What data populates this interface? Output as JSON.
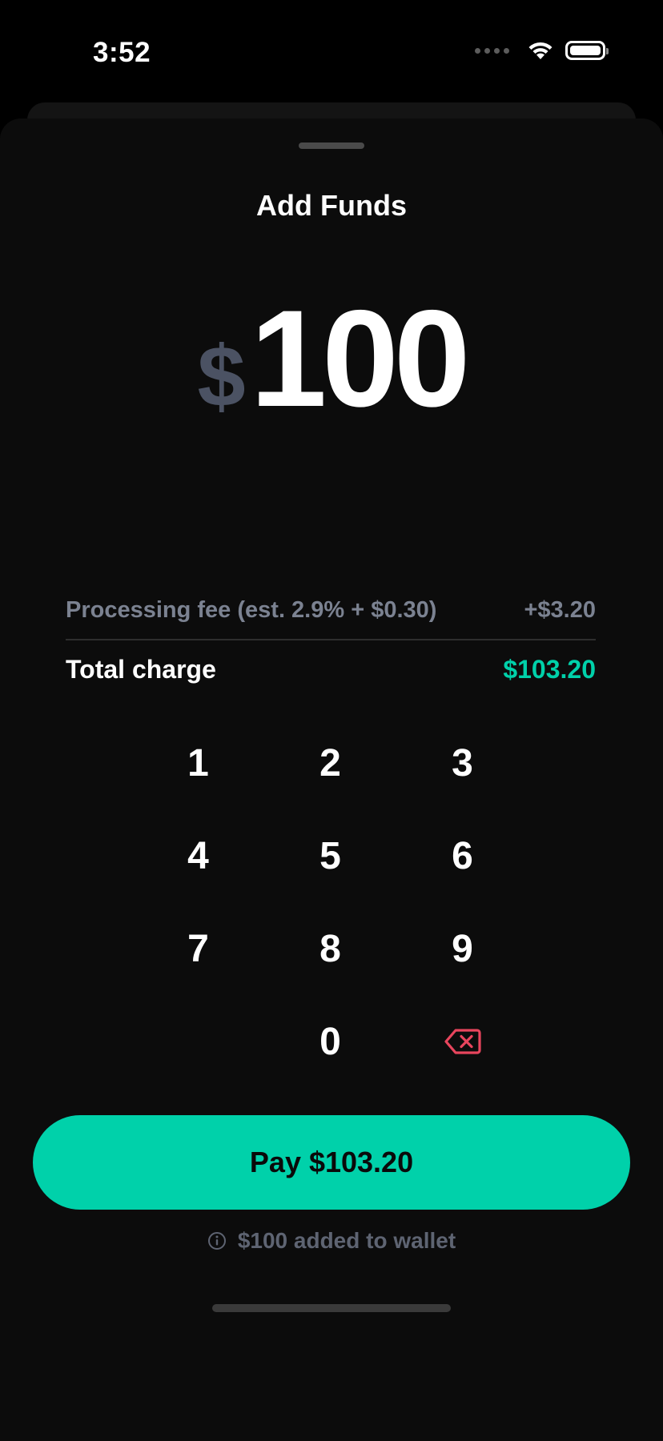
{
  "status_bar": {
    "time": "3:52"
  },
  "sheet": {
    "title": "Add Funds"
  },
  "amount": {
    "currency_symbol": "$",
    "value": "100"
  },
  "fees": {
    "processing_label": "Processing fee (est. 2.9% + $0.30)",
    "processing_value": "+$3.20",
    "total_label": "Total charge",
    "total_value": "$103.20"
  },
  "keypad": {
    "keys": [
      "1",
      "2",
      "3",
      "4",
      "5",
      "6",
      "7",
      "8",
      "9",
      "0"
    ],
    "backspace_icon": "backspace-icon"
  },
  "actions": {
    "pay_label": "Pay $103.20"
  },
  "note": {
    "icon": "info-icon",
    "text": "$100 added to wallet"
  },
  "colors": {
    "accent": "#00d1aa",
    "background": "#0c0c0c",
    "muted_text": "#7b8291",
    "currency_symbol": "#4b5263",
    "danger": "#e8455d"
  }
}
